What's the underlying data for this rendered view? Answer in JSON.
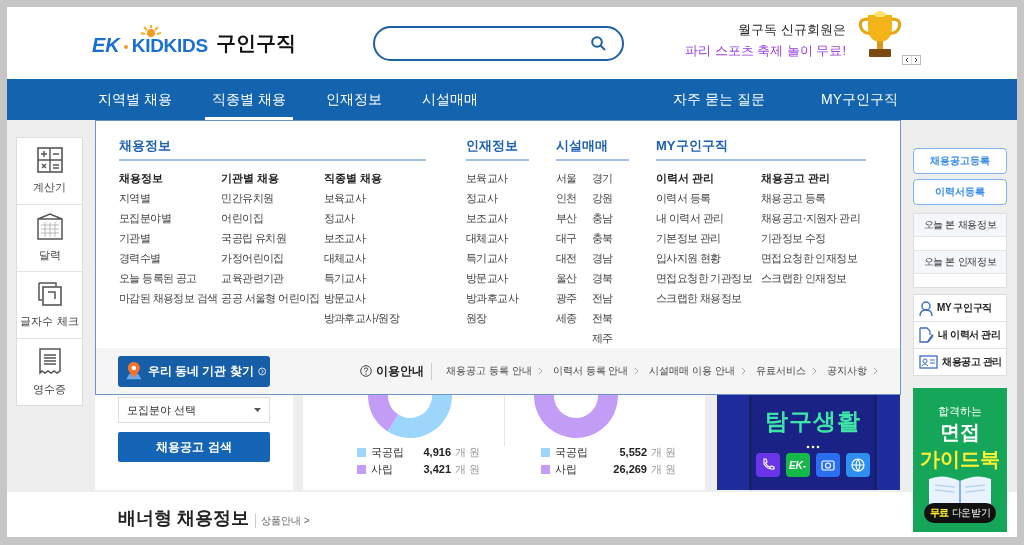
{
  "logo": {
    "mark": "EK",
    "brand": "KIDKIDS",
    "service": "구인구직"
  },
  "promo": {
    "line1": "월구독 신규회원은",
    "line2": "파리 스포츠 축제 놀이 무료!"
  },
  "nav": {
    "items": [
      {
        "label": "지역별 채용",
        "selected": false
      },
      {
        "label": "직종별 채용",
        "selected": true
      },
      {
        "label": "인재정보",
        "selected": false
      },
      {
        "label": "시설매매",
        "selected": false
      }
    ],
    "right_items": [
      "자주 묻는 질문",
      "MY구인구직"
    ]
  },
  "mega_menu": {
    "sections": [
      {
        "title": "채용정보",
        "columns": [
          {
            "heading": "채용정보",
            "items": [
              "지역별",
              "모집분야별",
              "기관별",
              "경력수별",
              "오늘 등록된 공고",
              "마감된 채용정보 검색"
            ]
          },
          {
            "heading": "기관별 채용",
            "items": [
              "민간유치원",
              "어린이집",
              "국공립 유치원",
              "가정어린이집",
              "교육관련기관",
              "공공 서울형 어린이집"
            ]
          },
          {
            "heading": "직종별 채용",
            "items": [
              "보육교사",
              "정교사",
              "보조교사",
              "대체교사",
              "특기교사",
              "방문교사",
              "방과후교사/원장"
            ]
          }
        ]
      },
      {
        "title": "인재정보",
        "columns": [
          {
            "items": [
              "보육교사",
              "정교사",
              "보조교사",
              "대체교사",
              "특기교사",
              "방문교사",
              "방과후교사",
              "원장"
            ]
          }
        ]
      },
      {
        "title": "시설매매",
        "columns": [
          {
            "items": [
              "서울",
              "인천",
              "부산",
              "대구",
              "대전",
              "울산",
              "광주",
              "세종"
            ]
          },
          {
            "items": [
              "경기",
              "강원",
              "충남",
              "충북",
              "경남",
              "경북",
              "전남",
              "전북",
              "제주"
            ]
          }
        ]
      },
      {
        "title": "MY구인구직",
        "columns": [
          {
            "heading": "이력서 관리",
            "items": [
              "이력서 등록",
              "내 이력서 관리",
              "기본정보 관리",
              "입사지원 현황",
              "면접요청한 기관정보",
              "스크랩한 채용정보"
            ]
          },
          {
            "heading": "채용공고 관리",
            "items": [
              "채용공고 등록",
              "채용공고·지원자 관리",
              "기관정보 수정",
              "면접요청한 인재정보",
              "스크랩한 인재정보"
            ]
          }
        ]
      }
    ],
    "find_button": "우리 동네 기관 찾기",
    "guide_title": "이용안내",
    "guide_links": [
      "채용공고 등록 안내",
      "이력서 등록 안내",
      "시설매매 이용 안내",
      "유료서비스",
      "공지사항"
    ]
  },
  "tools": [
    {
      "kind": "calculator",
      "label": "계산기"
    },
    {
      "kind": "calendar",
      "label": "달력"
    },
    {
      "kind": "wordcount",
      "label": "글자수 체크"
    },
    {
      "kind": "receipt",
      "label": "영수증"
    }
  ],
  "search_card": {
    "select": "모집분야 선택",
    "button": "채용공고 검색"
  },
  "stats": [
    {
      "legend": [
        {
          "label": "국공립",
          "value": "4,916",
          "unit": "개 원",
          "color": "#9dd6fb"
        },
        {
          "label": "사립",
          "value": "3,421",
          "unit": "개 원",
          "color": "#c39cf6"
        }
      ]
    },
    {
      "legend": [
        {
          "label": "국공립",
          "value": "5,552",
          "unit": "개 원",
          "color": "#9dd6fb"
        },
        {
          "label": "사립",
          "value": "26,269",
          "unit": "개 원",
          "color": "#c39cf6"
        }
      ]
    }
  ],
  "banner": {
    "headline": "탐구생활",
    "app_icons": [
      {
        "kind": "phone"
      },
      {
        "kind": "ek",
        "label": "EK-"
      },
      {
        "kind": "camera"
      },
      {
        "kind": "globe"
      }
    ]
  },
  "quick_menu": {
    "buttons": [
      "채용공고등록",
      "이력서등록"
    ],
    "recent": [
      "오늘 본 채용정보",
      "오늘 본 인재정보"
    ],
    "links": [
      {
        "kind": "person",
        "label": "MY 구인구직"
      },
      {
        "kind": "document",
        "label": "내 이력서 관리"
      },
      {
        "kind": "card",
        "label": "채용공고 관리"
      }
    ],
    "ad": {
      "line1": "합격하는",
      "line2": "면접",
      "line3": "가이드북",
      "pill_highlight": "무료",
      "pill_text": "다운받기"
    }
  },
  "section": {
    "title": "배너형 채용정보",
    "link": "상품안내 >"
  }
}
